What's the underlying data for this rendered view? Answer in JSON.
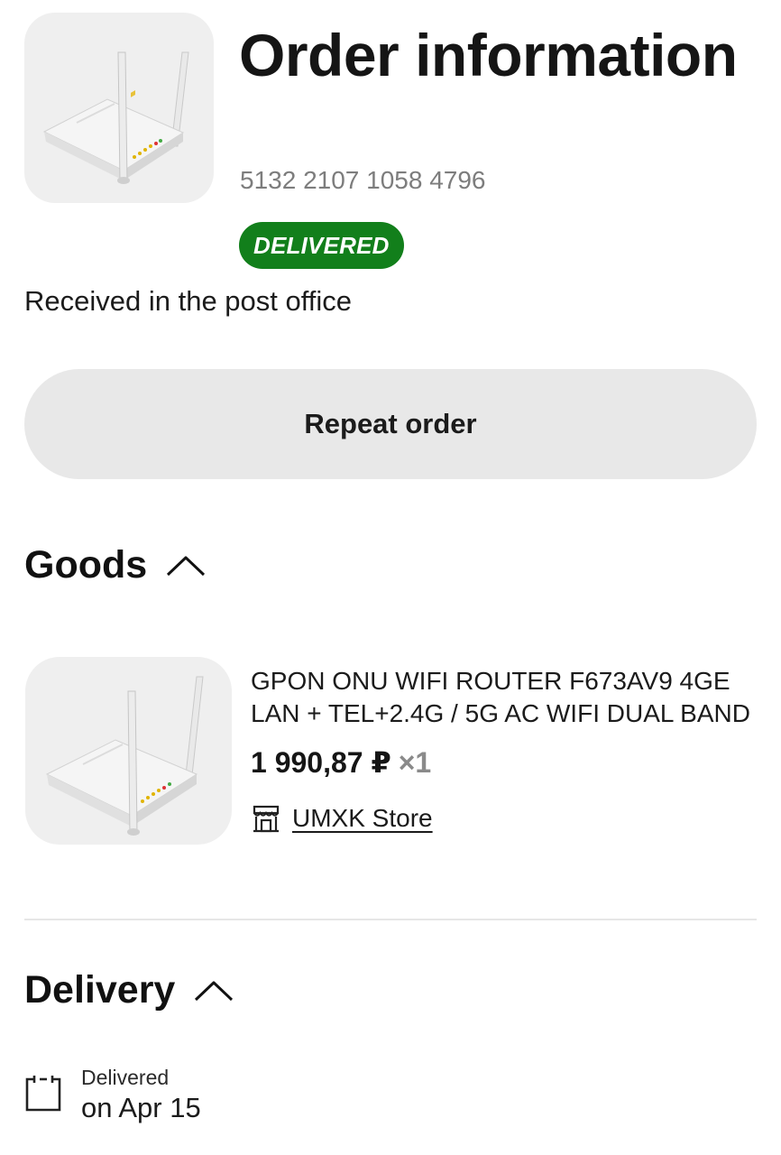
{
  "header": {
    "title": "Order information",
    "order_number": "5132 2107 1058 4796",
    "status_badge": "DELIVERED",
    "status_note": "Received in the post office",
    "product_image_icon": "router-image"
  },
  "actions": {
    "repeat_order_label": "Repeat order"
  },
  "goods": {
    "section_title": "Goods",
    "expanded": true,
    "items": [
      {
        "title": "GPON ONU WIFI ROUTER F673AV9 4GE LAN + TEL+2.4G / 5G AC WIFI DUAL BAND",
        "price": "1 990,87 ₽",
        "quantity": "×1",
        "store_name": "UMXK Store",
        "store_icon": "store-icon",
        "image_icon": "router-image"
      }
    ]
  },
  "delivery": {
    "section_title": "Delivery",
    "expanded": true,
    "status_label": "Delivered",
    "date": "on Apr 15",
    "icon": "calendar-icon"
  },
  "colors": {
    "badge_background": "#127f1b",
    "button_background": "#e8e8e8",
    "thumb_background": "#efefef",
    "secondary_text": "#7d7d7d",
    "divider": "#e6e6e6"
  }
}
